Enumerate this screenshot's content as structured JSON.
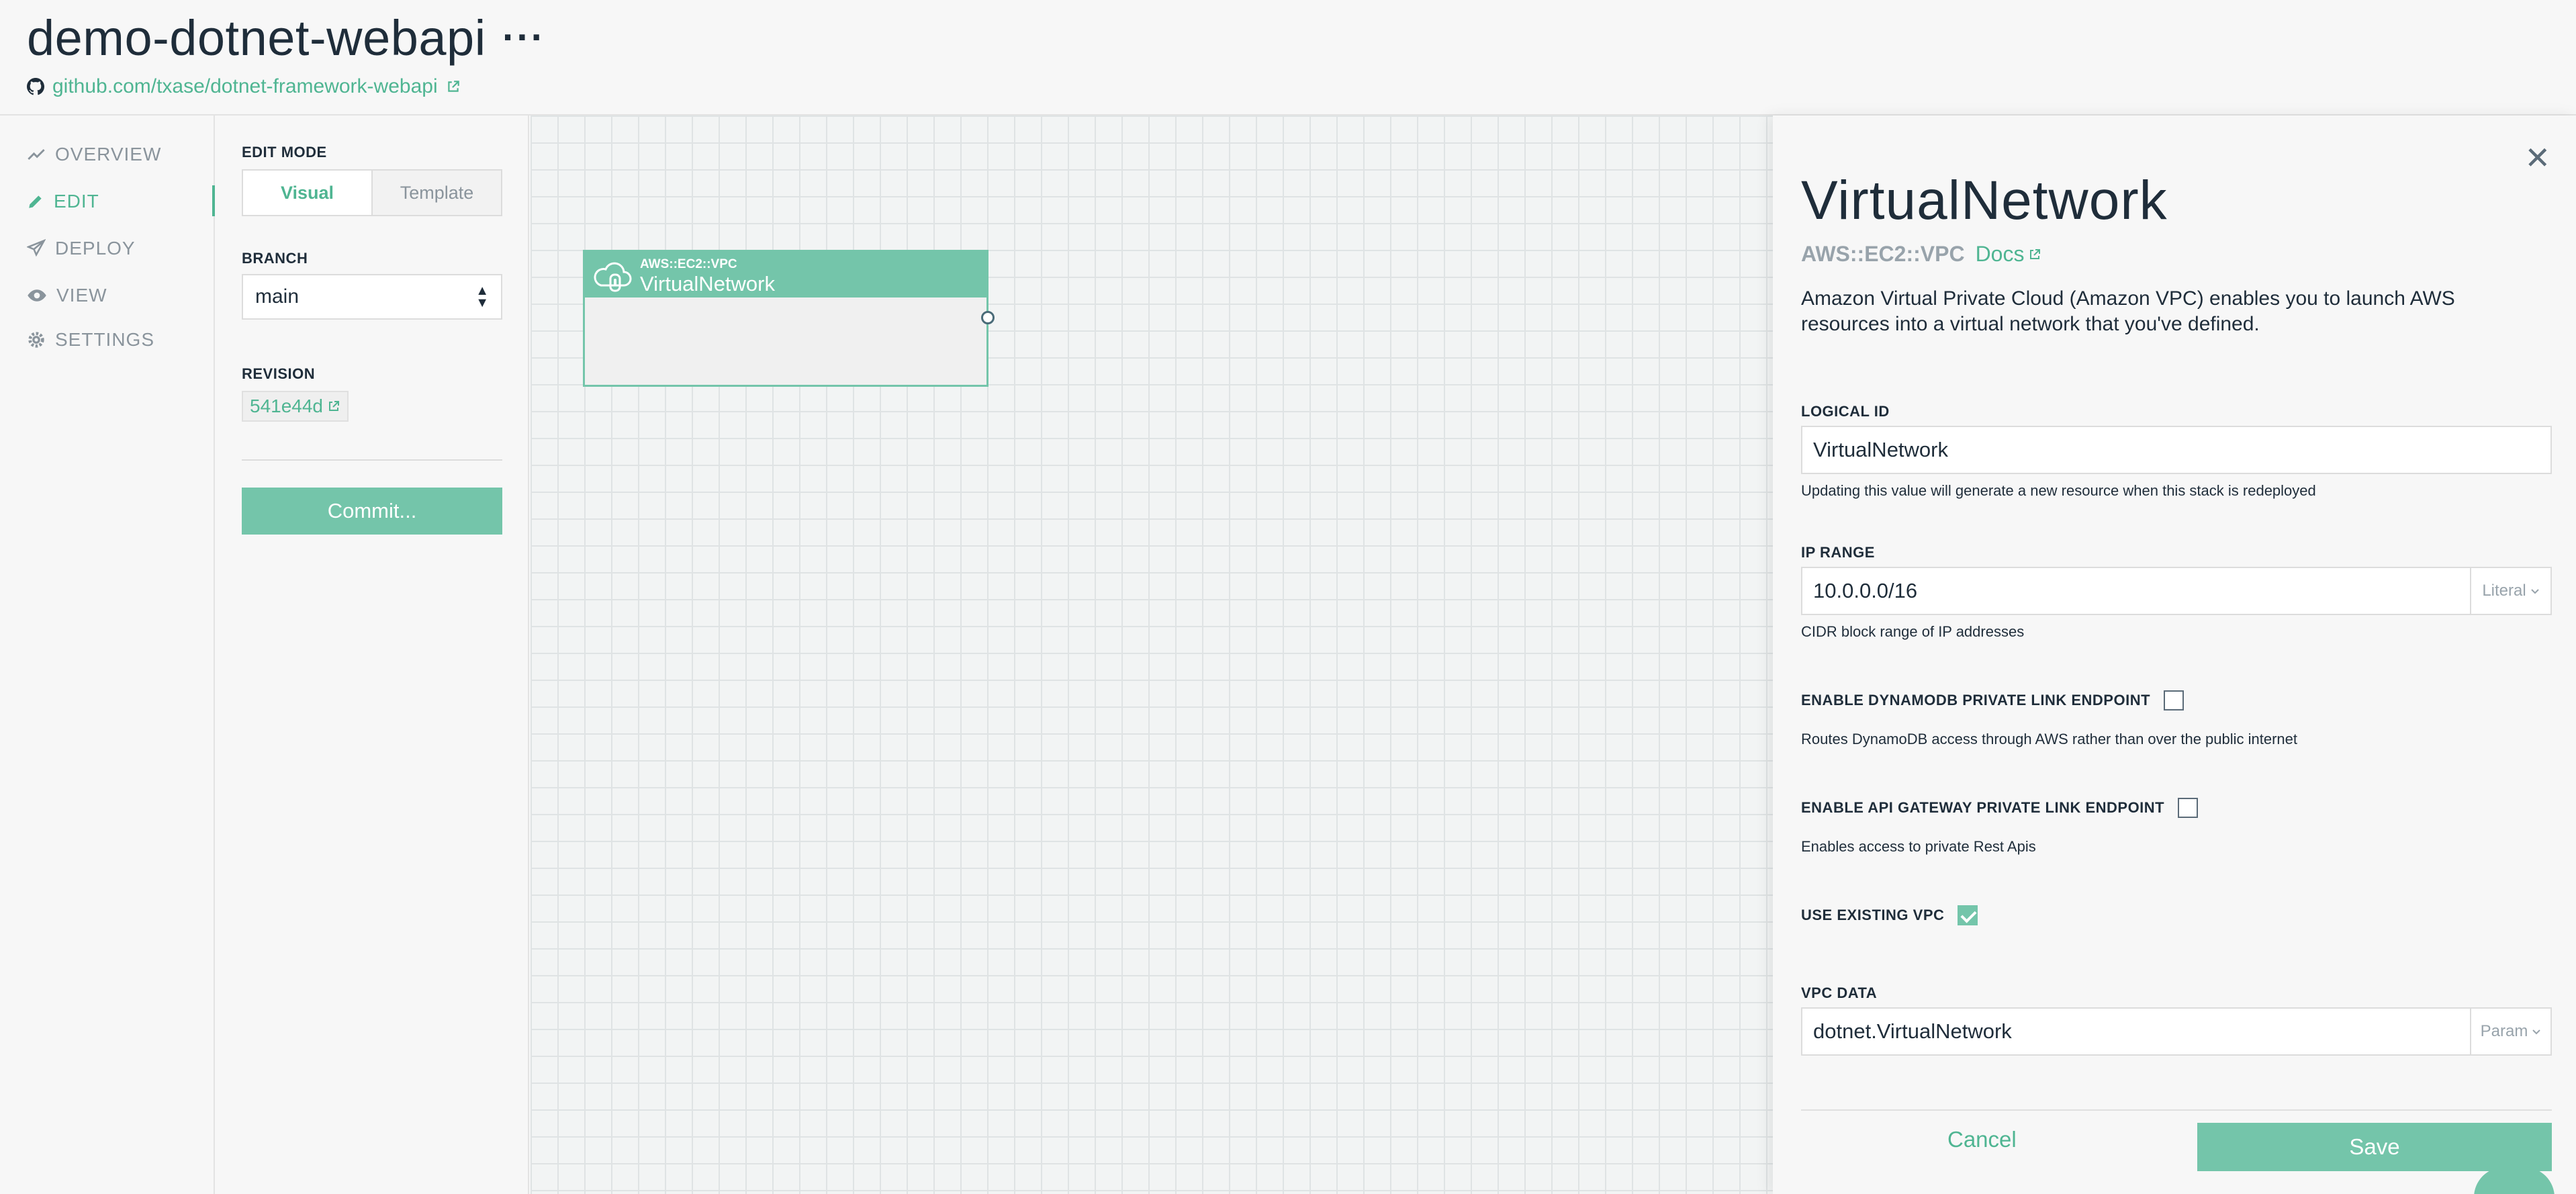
{
  "header": {
    "title": "demo-dotnet-webapi",
    "more_label": "···",
    "repo_link": "github.com/txase/dotnet-framework-webapi"
  },
  "nav": {
    "items": [
      {
        "label": "OVERVIEW",
        "icon": "trend-line-icon"
      },
      {
        "label": "EDIT",
        "icon": "pencil-icon",
        "active": true
      },
      {
        "label": "DEPLOY",
        "icon": "paper-plane-icon"
      },
      {
        "label": "VIEW",
        "icon": "eye-icon"
      },
      {
        "label": "SETTINGS",
        "icon": "gear-icon"
      }
    ]
  },
  "edit": {
    "mode_label": "EDIT MODE",
    "modes": [
      "Visual",
      "Template"
    ],
    "selected_mode": "Visual",
    "branch_label": "BRANCH",
    "branch_value": "main",
    "revision_label": "REVISION",
    "revision_value": "541e44d",
    "commit_label": "Commit..."
  },
  "canvas": {
    "node": {
      "type": "AWS::EC2::VPC",
      "name": "VirtualNetwork",
      "icon": "cloud-vpc-icon"
    }
  },
  "panel": {
    "title": "VirtualNetwork",
    "type": "AWS::EC2::VPC",
    "docs_label": "Docs",
    "description": "Amazon Virtual Private Cloud (Amazon VPC) enables you to launch AWS resources into a virtual network that you've defined.",
    "logical_id": {
      "label": "LOGICAL ID",
      "value": "VirtualNetwork",
      "help": "Updating this value will generate a new resource when this stack is redeployed"
    },
    "ip_range": {
      "label": "IP RANGE",
      "value": "10.0.0.0/16",
      "mode": "Literal",
      "help": "CIDR block range of IP addresses"
    },
    "dynamodb_endpoint": {
      "label": "ENABLE DYNAMODB PRIVATE LINK ENDPOINT",
      "checked": false,
      "help": "Routes DynamoDB access through AWS rather than over the public internet"
    },
    "apigw_endpoint": {
      "label": "ENABLE API GATEWAY PRIVATE LINK ENDPOINT",
      "checked": false,
      "help": "Enables access to private Rest Apis"
    },
    "use_existing_vpc": {
      "label": "USE EXISTING VPC",
      "checked": true
    },
    "vpc_data": {
      "label": "VPC DATA",
      "value": "dotnet.VirtualNetwork",
      "mode": "Param"
    },
    "cancel_label": "Cancel",
    "save_label": "Save"
  },
  "colors": {
    "accent": "#74c5aa",
    "accent_text": "#4fb592",
    "text": "#1f2d3a",
    "muted": "#8a949c"
  }
}
